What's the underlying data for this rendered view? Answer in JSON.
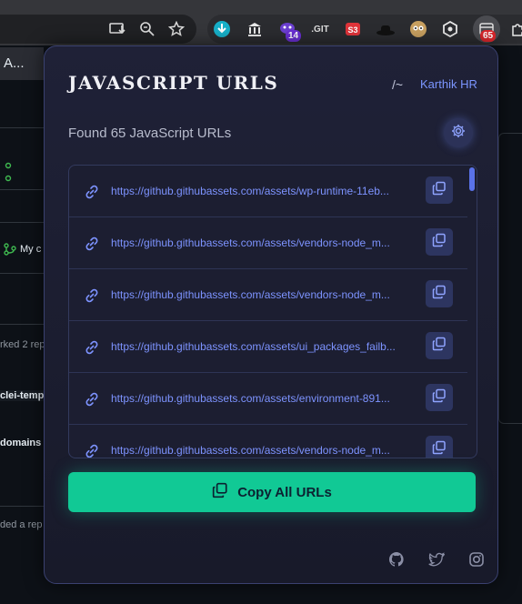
{
  "browser": {
    "badges": {
      "ext_purple": "14",
      "ext_red": "65"
    },
    "icons": [
      "install-icon",
      "zoom-icon",
      "star-icon",
      "download-extension-icon",
      "bank-extension-icon",
      "alien-extension-icon",
      "git-extension-icon",
      "s3-extension-icon",
      "hat-extension-icon",
      "owl-extension-icon",
      "hexagon-extension-icon",
      "js-urls-extension-icon",
      "extensions-icon"
    ]
  },
  "background": {
    "tab_label": "A...",
    "row_my": "My c",
    "text_forked": "rked 2 rep",
    "text_temp": "clei-temp",
    "text_domains": "domains",
    "text_added": "ded a rep"
  },
  "popup": {
    "title": "JAVASCRIPT URLS",
    "slash": "/~",
    "author": "Karthik HR",
    "found_text": "Found 65 JavaScript URLs",
    "urls": [
      "https://github.githubassets.com/assets/wp-runtime-11eb...",
      "https://github.githubassets.com/assets/vendors-node_m...",
      "https://github.githubassets.com/assets/vendors-node_m...",
      "https://github.githubassets.com/assets/ui_packages_failb...",
      "https://github.githubassets.com/assets/environment-891...",
      "https://github.githubassets.com/assets/vendors-node_m..."
    ],
    "copy_all_label": "Copy All URLs",
    "footer_icons": [
      "github-icon",
      "twitter-icon",
      "instagram-icon"
    ]
  },
  "colors": {
    "accent": "#7b95ff",
    "button_green": "#11c995",
    "popup_bg": "#1f2137"
  }
}
